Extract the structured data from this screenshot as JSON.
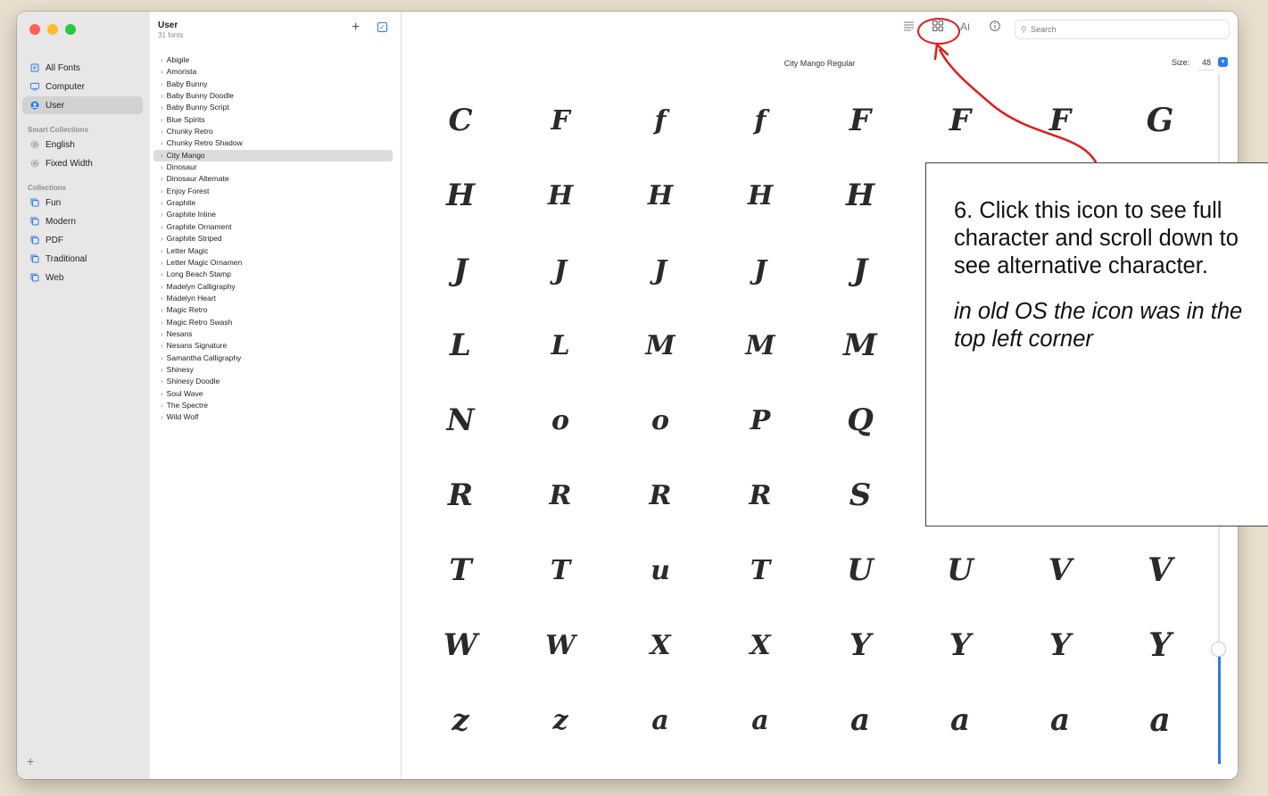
{
  "sidebar": {
    "window_controls": [
      "close",
      "minimize",
      "zoom"
    ],
    "items": [
      {
        "label": "All Fonts",
        "icon": "font-book-icon"
      },
      {
        "label": "Computer",
        "icon": "monitor-icon"
      },
      {
        "label": "User",
        "icon": "user-icon",
        "selected": true
      }
    ],
    "smart_collections_heading": "Smart Collections",
    "smart_collections": [
      {
        "label": "English",
        "icon": "gear-icon"
      },
      {
        "label": "Fixed Width",
        "icon": "gear-icon"
      }
    ],
    "collections_heading": "Collections",
    "collections": [
      {
        "label": "Fun",
        "icon": "collection-icon"
      },
      {
        "label": "Modern",
        "icon": "collection-icon"
      },
      {
        "label": "PDF",
        "icon": "collection-icon"
      },
      {
        "label": "Traditional",
        "icon": "collection-icon"
      },
      {
        "label": "Web",
        "icon": "collection-icon"
      }
    ],
    "add_label": "+"
  },
  "font_list": {
    "title": "User",
    "count": "31 fonts",
    "add_label": "+",
    "selected": "City Mango",
    "fonts": [
      "Abigile",
      "Amorista",
      "Baby Bunny",
      "Baby Bunny Doodle",
      "Baby Bunny Script",
      "Blue Spirits",
      "Chunky Retro",
      "Chunky Retro Shadow",
      "City Mango",
      "Dinosaur",
      "Dinosaur Alternate",
      "Enjoy Forest",
      "Graphite",
      "Graphite Inline",
      "Graphite Ornament",
      "Graphite Striped",
      "Letter Magic",
      "Letter Magic Ornamen",
      "Long Beach Stamp",
      "Madelyn Calligraphy",
      "Madelyn Heart",
      "Magic Retro",
      "Magic Retro Swash",
      "Nesans",
      "Nesans Signature",
      "Samantha Calligraphy",
      "Shinesy",
      "Shinesy Doodle",
      "Soul Wave",
      "The Spectre",
      "Wild Wolf"
    ]
  },
  "toolbar": {
    "icons": [
      "list-view-icon",
      "grid-view-icon",
      "text-size-icon",
      "info-icon"
    ],
    "search_placeholder": "Search"
  },
  "preview": {
    "font_name": "City Mango Regular",
    "size_label": "Size:",
    "size_value": "48",
    "size_slider_fraction": 0.15,
    "glyph_rows": [
      [
        "C",
        "F",
        "f",
        "f",
        "F",
        "F",
        "F",
        "G"
      ],
      [
        "H",
        "H",
        "H",
        "H",
        "H",
        "",
        "",
        ""
      ],
      [
        "J",
        "J",
        "J",
        "J",
        "J",
        "",
        "",
        ""
      ],
      [
        "L",
        "L",
        "M",
        "M",
        "M",
        "",
        "",
        ""
      ],
      [
        "N",
        "o",
        "o",
        "P",
        "Q",
        "",
        "",
        ""
      ],
      [
        "R",
        "R",
        "R",
        "R",
        "S",
        "",
        "",
        ""
      ],
      [
        "T",
        "T",
        "u",
        "T",
        "U",
        "U",
        "V",
        "V"
      ],
      [
        "W",
        "W",
        "X",
        "X",
        "Y",
        "Y",
        "Y",
        "Y"
      ],
      [
        "z",
        "z",
        "a",
        "a",
        "a",
        "a",
        "a",
        "a"
      ]
    ]
  },
  "annotation": {
    "color": "#e21a1a",
    "text": "6. Click this icon to see full character and scroll down to see alternative character.",
    "note": "in old OS the icon was in the top left corner"
  }
}
